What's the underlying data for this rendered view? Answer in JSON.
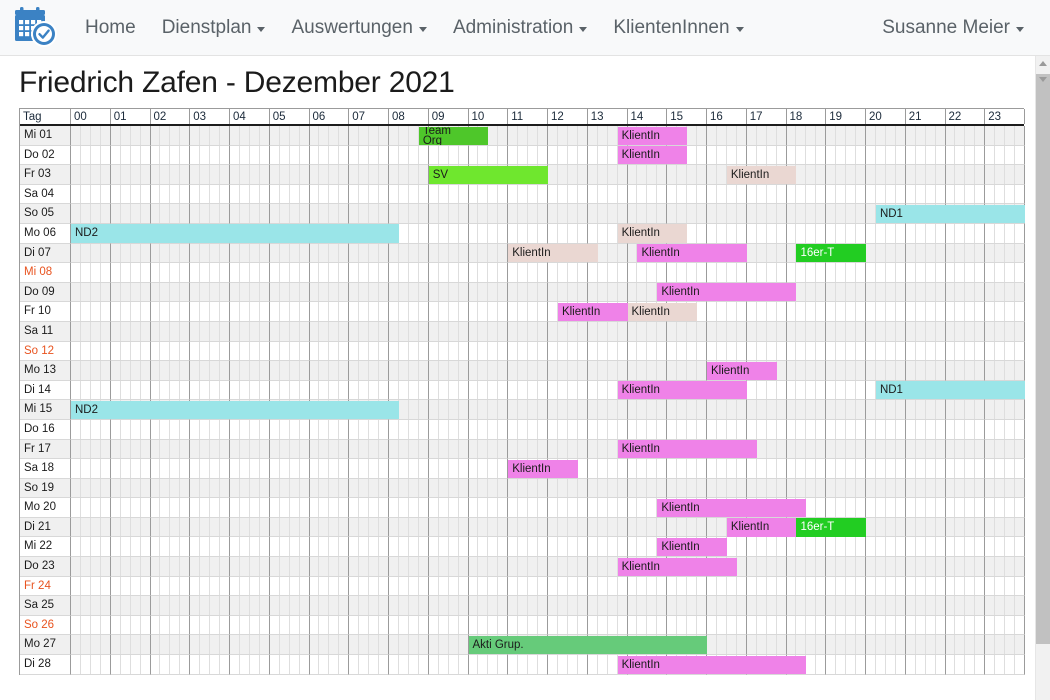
{
  "navbar": {
    "logo_icon": "calendar-check-icon",
    "items": [
      {
        "label": "Home",
        "has_caret": false
      },
      {
        "label": "Dienstplan",
        "has_caret": true
      },
      {
        "label": "Auswertungen",
        "has_caret": true
      },
      {
        "label": "Administration",
        "has_caret": true
      },
      {
        "label": "KlientenInnen",
        "has_caret": true
      }
    ],
    "user": {
      "label": "Susanne Meier",
      "has_caret": true
    }
  },
  "page": {
    "title": "Friedrich Zafen - Dezember 2021"
  },
  "gantt": {
    "day_column_header": "Tag",
    "hours": [
      "00",
      "01",
      "02",
      "03",
      "04",
      "05",
      "06",
      "07",
      "08",
      "09",
      "10",
      "11",
      "12",
      "13",
      "14",
      "15",
      "16",
      "17",
      "18",
      "19",
      "20",
      "21",
      "22",
      "23"
    ],
    "rows": [
      {
        "day": "Mi 01",
        "holiday": false,
        "events": [
          {
            "label": "Team Org",
            "color": "teamorg",
            "start": 8.75,
            "end": 10.5,
            "two_line": true
          },
          {
            "label": "KlientIn",
            "color": "klientin",
            "start": 13.75,
            "end": 15.5
          }
        ]
      },
      {
        "day": "Do 02",
        "holiday": false,
        "events": [
          {
            "label": "KlientIn",
            "color": "klientin",
            "start": 13.75,
            "end": 15.5
          }
        ]
      },
      {
        "day": "Fr 03",
        "holiday": false,
        "events": [
          {
            "label": "SV",
            "color": "sv",
            "start": 9.0,
            "end": 12.0
          },
          {
            "label": "KlientIn",
            "color": "klientin-l",
            "start": 16.5,
            "end": 18.25
          }
        ]
      },
      {
        "day": "Sa 04",
        "holiday": false,
        "events": []
      },
      {
        "day": "So 05",
        "holiday": false,
        "events": [
          {
            "label": "ND1",
            "color": "nd",
            "start": 20.25,
            "end": 24.0
          }
        ]
      },
      {
        "day": "Mo 06",
        "holiday": false,
        "events": [
          {
            "label": "ND2",
            "color": "nd",
            "start": 0.0,
            "end": 8.25
          },
          {
            "label": "KlientIn",
            "color": "klientin-l",
            "start": 13.75,
            "end": 15.5
          }
        ]
      },
      {
        "day": "Di 07",
        "holiday": false,
        "events": [
          {
            "label": "KlientIn",
            "color": "klientin-l",
            "start": 11.0,
            "end": 13.25
          },
          {
            "label": "KlientIn",
            "color": "klientin",
            "start": 14.25,
            "end": 17.0
          },
          {
            "label": "16er-T",
            "color": "16er",
            "start": 18.25,
            "end": 20.0
          }
        ]
      },
      {
        "day": "Mi 08",
        "holiday": true,
        "events": []
      },
      {
        "day": "Do 09",
        "holiday": false,
        "events": [
          {
            "label": "KlientIn",
            "color": "klientin",
            "start": 14.75,
            "end": 18.25
          }
        ]
      },
      {
        "day": "Fr 10",
        "holiday": false,
        "events": [
          {
            "label": "KlientIn",
            "color": "klientin",
            "start": 12.25,
            "end": 14.0
          },
          {
            "label": "KlientIn",
            "color": "klientin-l",
            "start": 14.0,
            "end": 15.75
          }
        ]
      },
      {
        "day": "Sa 11",
        "holiday": false,
        "events": []
      },
      {
        "day": "So 12",
        "holiday": true,
        "events": []
      },
      {
        "day": "Mo 13",
        "holiday": false,
        "events": [
          {
            "label": "KlientIn",
            "color": "klientin",
            "start": 16.0,
            "end": 17.75
          }
        ]
      },
      {
        "day": "Di 14",
        "holiday": false,
        "events": [
          {
            "label": "KlientIn",
            "color": "klientin",
            "start": 13.75,
            "end": 17.0
          },
          {
            "label": "ND1",
            "color": "nd",
            "start": 20.25,
            "end": 24.0
          }
        ]
      },
      {
        "day": "Mi 15",
        "holiday": false,
        "events": [
          {
            "label": "ND2",
            "color": "nd",
            "start": 0.0,
            "end": 8.25
          }
        ]
      },
      {
        "day": "Do 16",
        "holiday": false,
        "events": []
      },
      {
        "day": "Fr 17",
        "holiday": false,
        "events": [
          {
            "label": "KlientIn",
            "color": "klientin",
            "start": 13.75,
            "end": 17.25
          }
        ]
      },
      {
        "day": "Sa 18",
        "holiday": false,
        "events": [
          {
            "label": "KlientIn",
            "color": "klientin",
            "start": 11.0,
            "end": 12.75
          }
        ]
      },
      {
        "day": "So 19",
        "holiday": false,
        "events": []
      },
      {
        "day": "Mo 20",
        "holiday": false,
        "events": [
          {
            "label": "KlientIn",
            "color": "klientin",
            "start": 14.75,
            "end": 18.5
          }
        ]
      },
      {
        "day": "Di 21",
        "holiday": false,
        "events": [
          {
            "label": "KlientIn",
            "color": "klientin",
            "start": 16.5,
            "end": 18.25
          },
          {
            "label": "16er-T",
            "color": "16er",
            "start": 18.25,
            "end": 20.0
          }
        ]
      },
      {
        "day": "Mi 22",
        "holiday": false,
        "events": [
          {
            "label": "KlientIn",
            "color": "klientin",
            "start": 14.75,
            "end": 16.5
          }
        ]
      },
      {
        "day": "Do 23",
        "holiday": false,
        "events": [
          {
            "label": "KlientIn",
            "color": "klientin",
            "start": 13.75,
            "end": 16.75
          }
        ]
      },
      {
        "day": "Fr 24",
        "holiday": true,
        "events": []
      },
      {
        "day": "Sa 25",
        "holiday": false,
        "events": []
      },
      {
        "day": "So 26",
        "holiday": true,
        "events": []
      },
      {
        "day": "Mo 27",
        "holiday": false,
        "events": [
          {
            "label": "Akti Grup.",
            "color": "akti",
            "start": 10.0,
            "end": 16.0
          }
        ]
      },
      {
        "day": "Di 28",
        "holiday": false,
        "events": [
          {
            "label": "KlientIn",
            "color": "klientin",
            "start": 13.75,
            "end": 18.5
          }
        ]
      }
    ]
  },
  "colors": {
    "klientin": "#ef82e8",
    "klientin_light": "#ead7d2",
    "nachtdienst": "#9ae5e8",
    "team_org": "#4ec72a",
    "sv": "#6fe72e",
    "sechzehner": "#22cd22",
    "akti_gruppe": "#66cb7a",
    "holiday_text": "#e8531f",
    "nav_text": "#5a6268",
    "brand": "#3b82c4"
  },
  "scrollbar": {
    "up_icon": "chevron-up-icon",
    "down_icon": "chevron-down-icon"
  }
}
